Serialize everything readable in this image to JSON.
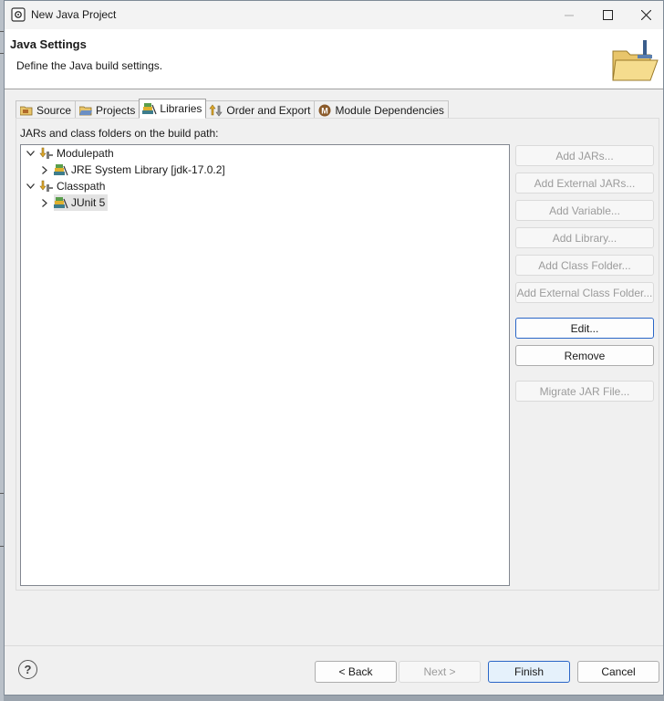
{
  "window": {
    "title": "New Java Project",
    "app_icon": "eclipse-gear-icon"
  },
  "header": {
    "title": "Java Settings",
    "description": "Define the Java build settings.",
    "image": "open-folder-wizard-icon"
  },
  "tabs": [
    {
      "label": "Source",
      "icon": "source-folder-icon",
      "active": false
    },
    {
      "label": "Projects",
      "icon": "project-folder-icon",
      "active": false
    },
    {
      "label": "Libraries",
      "icon": "library-books-icon",
      "active": true
    },
    {
      "label": "Order and Export",
      "icon": "order-export-icon",
      "active": false
    },
    {
      "label": "Module Dependencies",
      "icon": "module-icon",
      "active": false
    }
  ],
  "libraries": {
    "label": "JARs and class folders on the build path:",
    "tree": [
      {
        "label": "Modulepath",
        "icon": "classpath-icon",
        "expanded": true
      },
      {
        "label": "JRE System Library [jdk-17.0.2]",
        "icon": "library-icon",
        "expanded": false
      },
      {
        "label": "Classpath",
        "icon": "classpath-icon",
        "expanded": true
      },
      {
        "label": "JUnit 5",
        "icon": "library-icon",
        "expanded": false,
        "selected": true
      }
    ],
    "buttons": {
      "add_jars": "Add JARs...",
      "add_external_jars": "Add External JARs...",
      "add_variable": "Add Variable...",
      "add_library": "Add Library...",
      "add_class_folder": "Add Class Folder...",
      "add_external_class_folder": "Add External Class Folder...",
      "edit": "Edit...",
      "remove": "Remove",
      "migrate_jar": "Migrate JAR File..."
    }
  },
  "footer": {
    "help": "?",
    "back": "< Back",
    "next": "Next >",
    "finish": "Finish",
    "cancel": "Cancel"
  }
}
